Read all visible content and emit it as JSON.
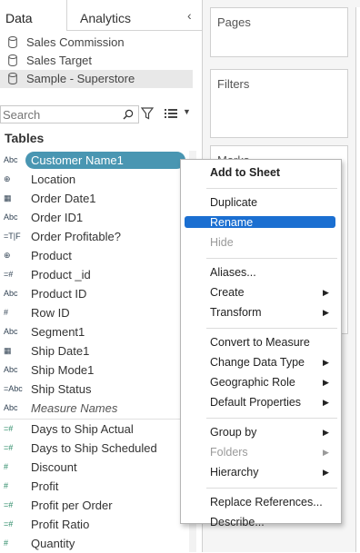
{
  "tabs": {
    "data": "Data",
    "analytics": "Analytics",
    "collapse_icon": "chevron-left-icon"
  },
  "data_sources": [
    {
      "label": "Sales Commission",
      "icon": "database-icon",
      "selected": false
    },
    {
      "label": "Sales Target",
      "icon": "database-icon",
      "selected": false
    },
    {
      "label": "Sample - Superstore",
      "icon": "database-icon",
      "selected": true
    }
  ],
  "search": {
    "placeholder": "Search",
    "value": ""
  },
  "tables_heading": "Tables",
  "fields": [
    {
      "icon": "Abc",
      "label": "Customer Name1",
      "kind": "dimension",
      "highlighted": true
    },
    {
      "icon": "⊕",
      "label": "Location",
      "kind": "dimension"
    },
    {
      "icon": "▦",
      "label": "Order Date1",
      "kind": "dimension"
    },
    {
      "icon": "Abc",
      "label": "Order ID1",
      "kind": "dimension"
    },
    {
      "icon": "=T|F",
      "label": "Order Profitable?",
      "kind": "dimension"
    },
    {
      "icon": "⊕",
      "label": "Product",
      "kind": "dimension"
    },
    {
      "icon": "=#",
      "label": "Product _id",
      "kind": "dimension"
    },
    {
      "icon": "Abc",
      "label": "Product ID",
      "kind": "dimension"
    },
    {
      "icon": "#",
      "label": "Row ID",
      "kind": "dimension"
    },
    {
      "icon": "Abc",
      "label": "Segment1",
      "kind": "dimension"
    },
    {
      "icon": "▦",
      "label": "Ship Date1",
      "kind": "dimension"
    },
    {
      "icon": "Abc",
      "label": "Ship Mode1",
      "kind": "dimension"
    },
    {
      "icon": "=Abc",
      "label": "Ship Status",
      "kind": "dimension"
    },
    {
      "icon": "Abc",
      "label": "Measure Names",
      "kind": "dimension",
      "italic": true
    },
    {
      "icon": "=#",
      "label": "Days to Ship Actual",
      "kind": "measure",
      "divider_before": true
    },
    {
      "icon": "=#",
      "label": "Days to Ship Scheduled",
      "kind": "measure"
    },
    {
      "icon": "#",
      "label": "Discount",
      "kind": "measure"
    },
    {
      "icon": "#",
      "label": "Profit",
      "kind": "measure"
    },
    {
      "icon": "=#",
      "label": "Profit per Order",
      "kind": "measure"
    },
    {
      "icon": "=#",
      "label": "Profit Ratio",
      "kind": "measure"
    },
    {
      "icon": "#",
      "label": "Quantity",
      "kind": "measure"
    }
  ],
  "shelves": {
    "pages": "Pages",
    "filters": "Filters",
    "marks": "Marks"
  },
  "context_menu": [
    {
      "label": "Add to Sheet",
      "bold": true
    },
    {
      "separator": true
    },
    {
      "label": "Duplicate"
    },
    {
      "label": "Rename",
      "active": true
    },
    {
      "label": "Hide",
      "disabled": true
    },
    {
      "separator": true
    },
    {
      "label": "Aliases..."
    },
    {
      "label": "Create",
      "submenu": true
    },
    {
      "label": "Transform",
      "submenu": true
    },
    {
      "separator": true
    },
    {
      "label": "Convert to Measure"
    },
    {
      "label": "Change Data Type",
      "submenu": true
    },
    {
      "label": "Geographic Role",
      "submenu": true
    },
    {
      "label": "Default Properties",
      "submenu": true
    },
    {
      "separator": true
    },
    {
      "label": "Group by",
      "submenu": true
    },
    {
      "label": "Folders",
      "submenu": true,
      "disabled": true
    },
    {
      "label": "Hierarchy",
      "submenu": true
    },
    {
      "separator": true
    },
    {
      "label": "Replace References..."
    },
    {
      "label": "Describe..."
    }
  ],
  "colors": {
    "pill": "#4996b2",
    "menu_active": "#1b6fd1",
    "measure_icon": "#2a8a66"
  }
}
